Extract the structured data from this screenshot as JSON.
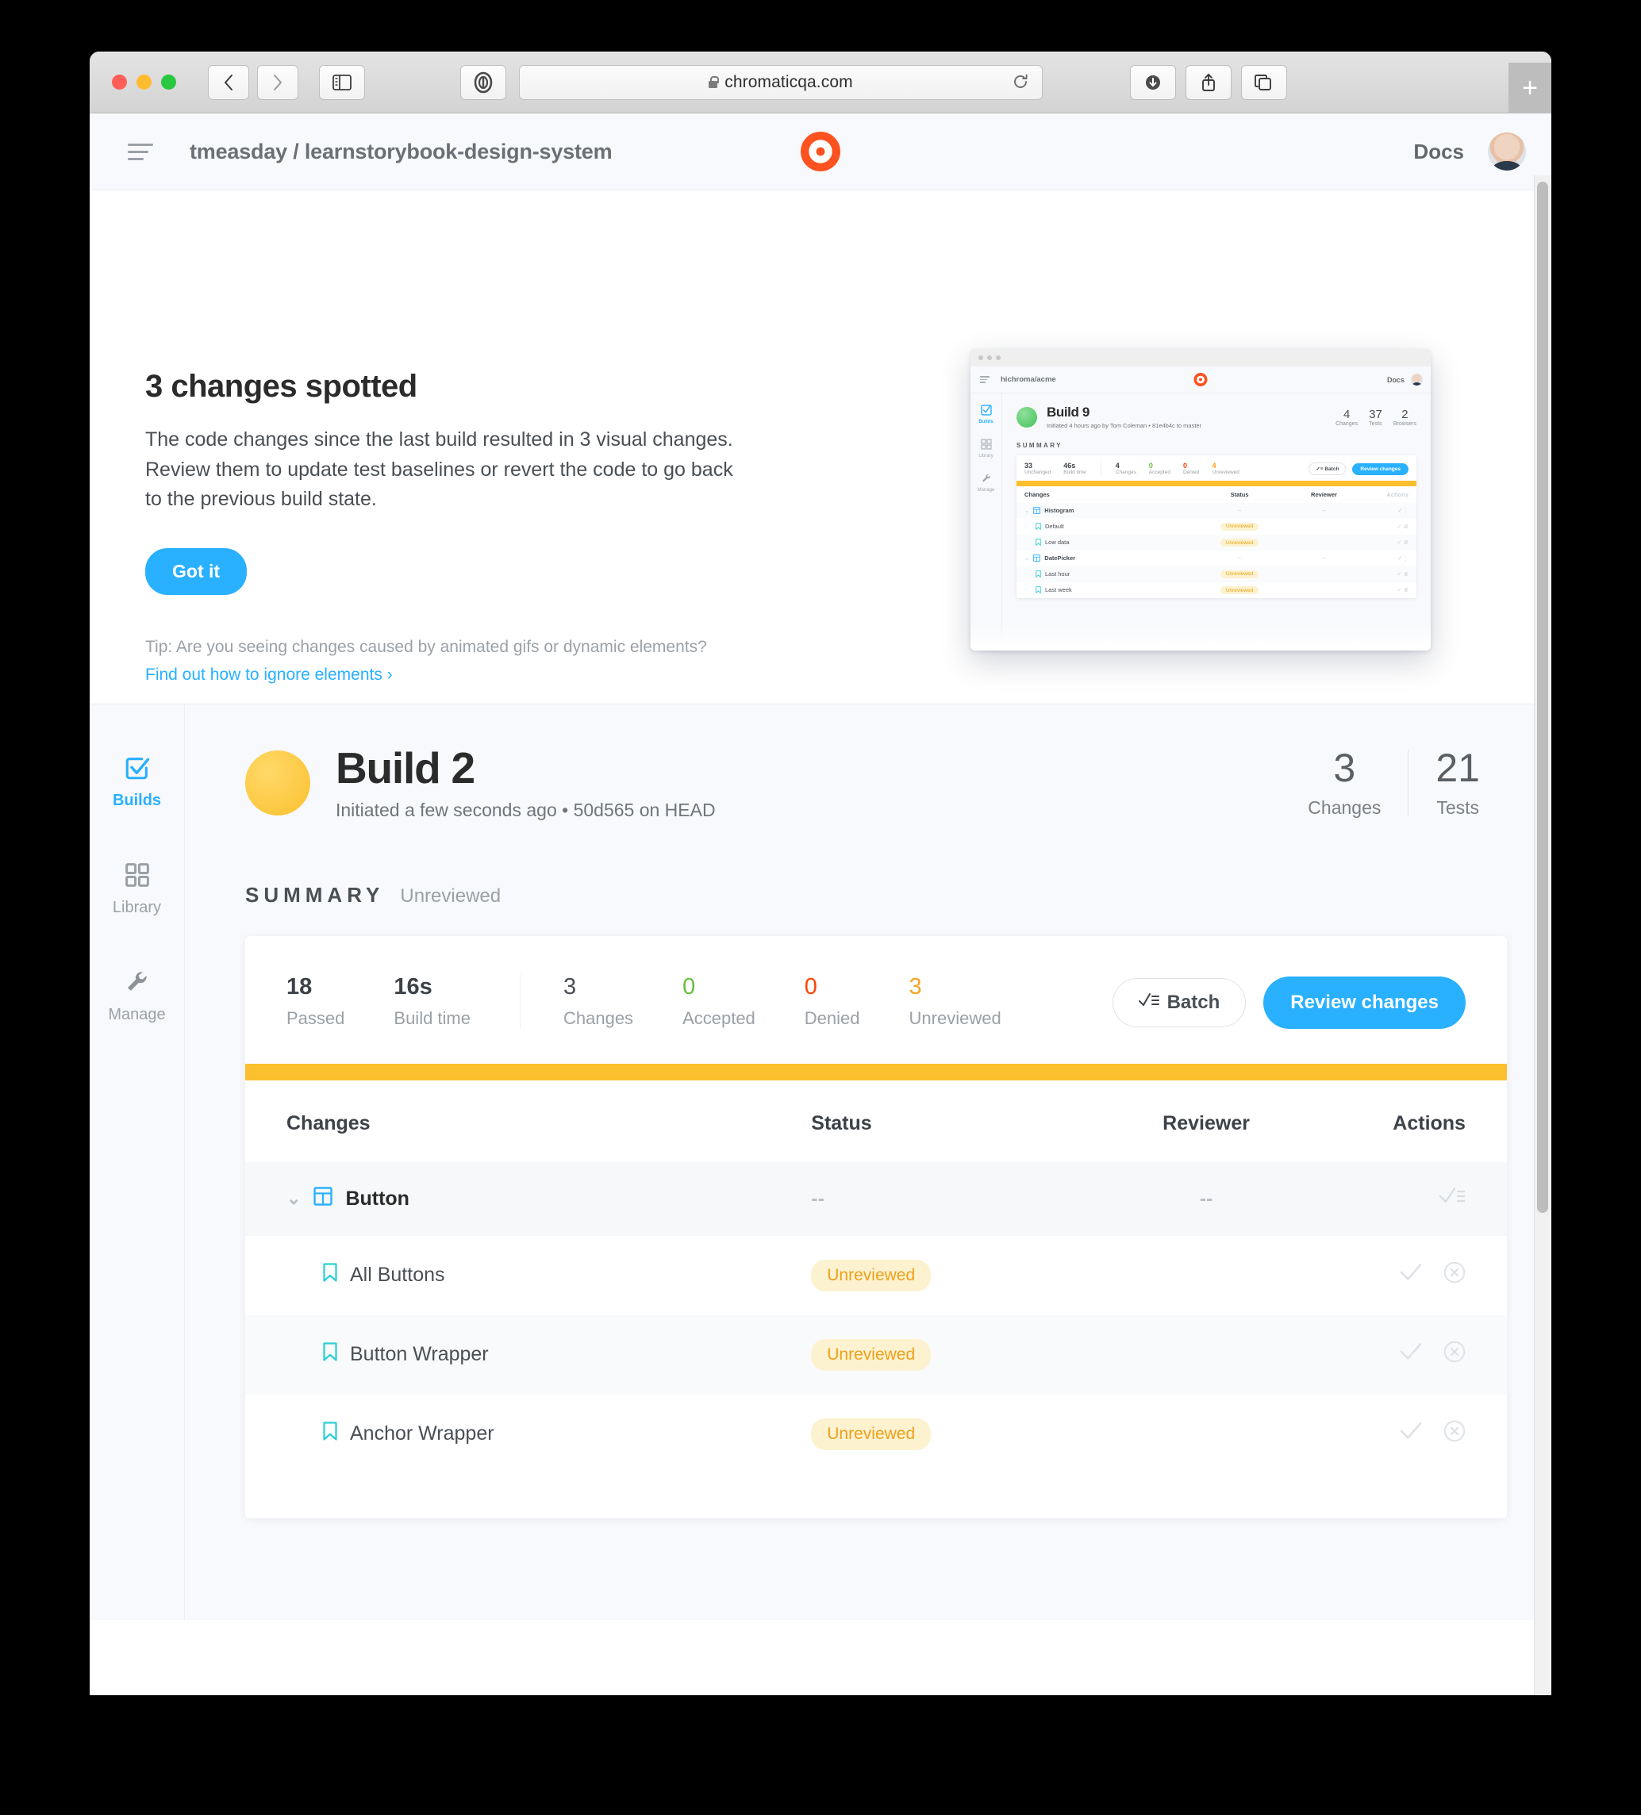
{
  "browser": {
    "url": "chromaticqa.com",
    "lock_icon": "lock-icon",
    "back_icon": "‹",
    "forward_icon": "›",
    "reload_icon": "↻",
    "newtab_label": "+"
  },
  "app_header": {
    "breadcrumb": "tmeasday / learnstorybook-design-system",
    "docs_label": "Docs"
  },
  "promo": {
    "title": "3 changes spotted",
    "body": "The code changes since the last build resulted in 3 visual changes. Review them to update test baselines or revert the code to go back to the previous build state.",
    "got_it_label": "Got it",
    "tip_text": "Tip: Are you seeing changes caused by animated gifs or dynamic elements?",
    "tip_link": "Find out how to ignore elements ›"
  },
  "preview": {
    "breadcrumb": "hichroma/acme",
    "docs_label": "Docs",
    "build_title": "Build 9",
    "build_sub": "Initiated 4 hours ago by Tom Coleman • 81e4b4c to master",
    "stats": [
      {
        "value": "4",
        "label": "Changes"
      },
      {
        "value": "37",
        "label": "Tests"
      },
      {
        "value": "2",
        "label": "Browsers"
      }
    ],
    "summary_label": "SUMMARY",
    "metrics": [
      {
        "value": "33",
        "label": "Unchanged",
        "tone": "plain"
      },
      {
        "value": "46s",
        "label": "Build time",
        "tone": "plain"
      },
      {
        "value": "4",
        "label": "Changes",
        "tone": "plain"
      },
      {
        "value": "0",
        "label": "Accepted",
        "tone": "green"
      },
      {
        "value": "0",
        "label": "Denied",
        "tone": "red"
      },
      {
        "value": "4",
        "label": "Unreviewed",
        "tone": "amber"
      }
    ],
    "batch_label": "✓≡ Batch",
    "review_label": "Review changes",
    "columns": [
      "Changes",
      "Status",
      "Reviewer",
      "Actions"
    ],
    "rows": [
      {
        "name": "Histogram",
        "type": "group",
        "status": "--",
        "reviewer": "--"
      },
      {
        "name": "Default",
        "type": "item",
        "status": "Unreviewed",
        "reviewer": ""
      },
      {
        "name": "Low data",
        "type": "item",
        "status": "Unreviewed",
        "reviewer": ""
      },
      {
        "name": "DatePicker",
        "type": "group",
        "status": "--",
        "reviewer": "--"
      },
      {
        "name": "Last hour",
        "type": "item",
        "status": "Unreviewed",
        "reviewer": ""
      },
      {
        "name": "Last week",
        "type": "item",
        "status": "Unreviewed",
        "reviewer": ""
      }
    ]
  },
  "sidebar": {
    "items": [
      {
        "label": "Builds",
        "icon": "checkbox-icon",
        "active": true
      },
      {
        "label": "Library",
        "icon": "grid-icon",
        "active": false
      },
      {
        "label": "Manage",
        "icon": "wrench-icon",
        "active": false
      }
    ]
  },
  "build": {
    "title": "Build 2",
    "subtitle": "Initiated a few seconds ago • 50d565 on HEAD",
    "status_color": "#fbc02d",
    "stats": [
      {
        "value": "3",
        "label": "Changes"
      },
      {
        "value": "21",
        "label": "Tests"
      }
    ]
  },
  "summary": {
    "heading": "SUMMARY",
    "state": "Unreviewed",
    "metrics": [
      {
        "value": "18",
        "label": "Passed",
        "tone": "bold"
      },
      {
        "value": "16s",
        "label": "Build time",
        "tone": "bold"
      },
      {
        "value": "3",
        "label": "Changes",
        "tone": "plain"
      },
      {
        "value": "0",
        "label": "Accepted",
        "tone": "green"
      },
      {
        "value": "0",
        "label": "Denied",
        "tone": "red"
      },
      {
        "value": "3",
        "label": "Unreviewed",
        "tone": "amber"
      }
    ],
    "batch_label": "Batch",
    "batch_icon": "check-list-icon",
    "review_label": "Review changes",
    "accent_stripe": "#fcc02e"
  },
  "table": {
    "columns": [
      "Changes",
      "Status",
      "Reviewer",
      "Actions"
    ],
    "rows": [
      {
        "name": "Button",
        "type": "group",
        "icon": "component-icon",
        "status": "--",
        "reviewer": "--",
        "actions": "batch-icon"
      },
      {
        "name": "All Buttons",
        "type": "item",
        "icon": "bookmark-icon",
        "status": "Unreviewed",
        "reviewer": "",
        "actions": "accept-deny"
      },
      {
        "name": "Button Wrapper",
        "type": "item",
        "icon": "bookmark-icon",
        "status": "Unreviewed",
        "reviewer": "",
        "actions": "accept-deny"
      },
      {
        "name": "Anchor Wrapper",
        "type": "item",
        "icon": "bookmark-icon",
        "status": "Unreviewed",
        "reviewer": "",
        "actions": "accept-deny"
      }
    ]
  },
  "colors": {
    "accent_blue": "#29b0ff",
    "brand_orange": "#fc521f",
    "warning_yellow": "#fcc02e",
    "green": "#66bf3c",
    "red": "#ff4400"
  }
}
